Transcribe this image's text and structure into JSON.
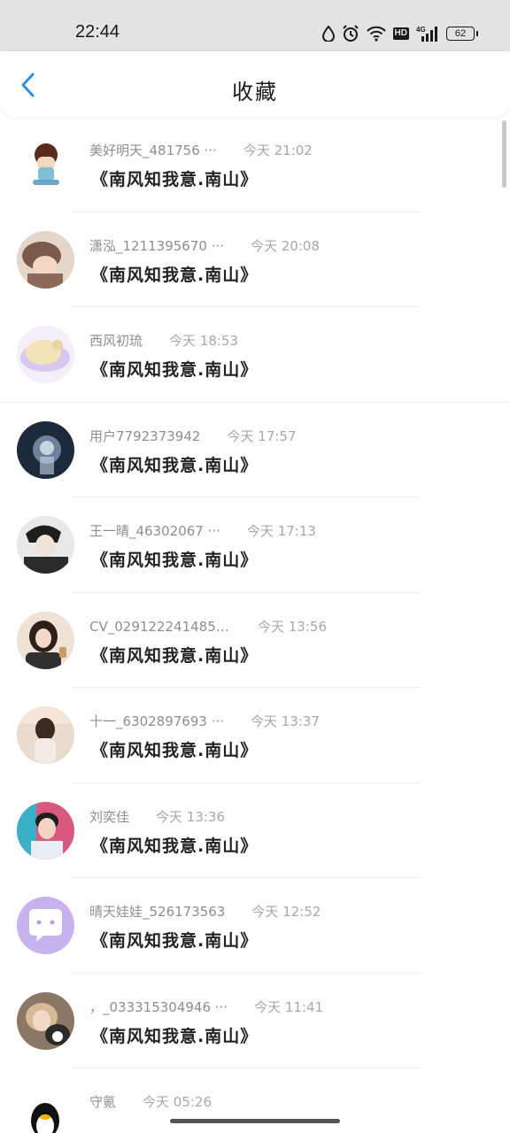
{
  "status_bar": {
    "time": "22:44",
    "battery": "62",
    "network_badge": "HD",
    "network_type": "4G"
  },
  "header": {
    "title": "收藏"
  },
  "items": [
    {
      "name": "美好明天_481756 ···",
      "time": "今天 21:02",
      "title": "《南风知我意.南山》",
      "avatar_color": "#e8c9a8"
    },
    {
      "name": "潇泓_1211395670 ···",
      "time": "今天 20:08",
      "title": "《南风知我意.南山》",
      "avatar_color": "#b59a88"
    },
    {
      "name": "西风初琉",
      "time": "今天 18:53",
      "title": "《南风知我意.南山》",
      "avatar_color": "#efe3c6"
    },
    {
      "name": "用户7792373942",
      "time": "今天 17:57",
      "title": "《南风知我意.南山》",
      "avatar_color": "#2a3a52"
    },
    {
      "name": "王一晴_46302067 ···",
      "time": "今天 17:13",
      "title": "《南风知我意.南山》",
      "avatar_color": "#3b3b3b"
    },
    {
      "name": "CV_029122241485 ···",
      "time": "今天 13:56",
      "title": "《南风知我意.南山》",
      "avatar_color": "#d9c3b3"
    },
    {
      "name": "十一_6302897693 ···",
      "time": "今天 13:37",
      "title": "《南风知我意.南山》",
      "avatar_color": "#cdb5a0"
    },
    {
      "name": "刘奕佳",
      "time": "今天 13:36",
      "title": "《南风知我意.南山》",
      "avatar_color": "#d6587a"
    },
    {
      "name": "晴天娃娃_526173563",
      "time": "今天 12:52",
      "title": "《南风知我意.南山》",
      "avatar_color": "#c8b2f0"
    },
    {
      "name": "，_033315304946 ···",
      "time": "今天 11:41",
      "title": "《南风知我意.南山》",
      "avatar_color": "#6b5a4c"
    },
    {
      "name": "守氪",
      "time": "今天 05:26",
      "title": "",
      "avatar_color": "#ffffff"
    }
  ]
}
